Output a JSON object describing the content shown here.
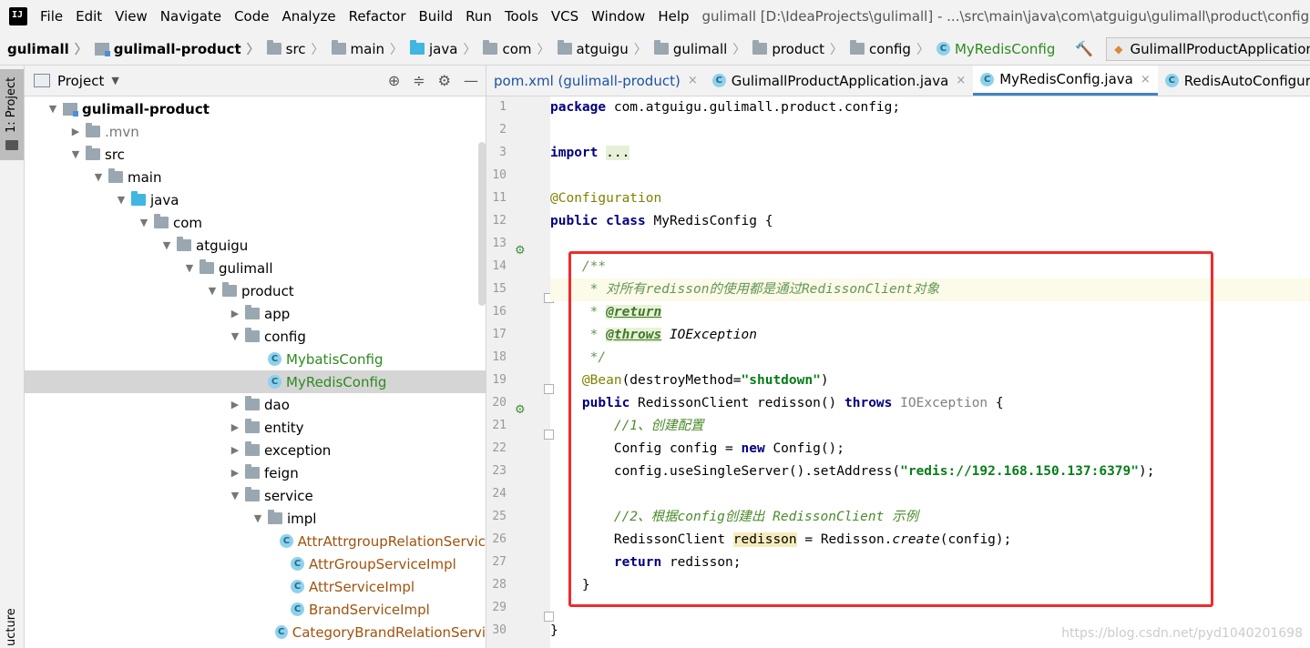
{
  "menubar": {
    "logo_text": "IJ",
    "items": [
      "File",
      "Edit",
      "View",
      "Navigate",
      "Code",
      "Analyze",
      "Refactor",
      "Build",
      "Run",
      "Tools",
      "VCS",
      "Window",
      "Help"
    ],
    "title": "gulimall [D:\\IdeaProjects\\gulimall] - ...\\src\\main\\java\\com\\atguigu\\gulimall\\product\\config"
  },
  "breadcrumb": {
    "items": [
      "gulimall",
      "gulimall-product",
      "src",
      "main",
      "java",
      "com",
      "atguigu",
      "gulimall",
      "product",
      "config",
      "MyRedisConfig"
    ],
    "run_config": "GulimallProductApplicationTests.redisson"
  },
  "side_tabs": {
    "project": "1: Project",
    "structure": "ucture"
  },
  "project_panel": {
    "title": "Project",
    "tree": [
      {
        "label": "gulimall-product",
        "depth": 0,
        "icon": "module-icon",
        "arrow": "down",
        "style": "bold"
      },
      {
        "label": ".mvn",
        "depth": 1,
        "icon": "folder-icon",
        "arrow": "right",
        "style": "gray"
      },
      {
        "label": "src",
        "depth": 1,
        "icon": "folder-icon",
        "arrow": "down",
        "style": ""
      },
      {
        "label": "main",
        "depth": 2,
        "icon": "folder-icon",
        "arrow": "down",
        "style": ""
      },
      {
        "label": "java",
        "depth": 3,
        "icon": "source-folder-icon",
        "arrow": "down",
        "style": ""
      },
      {
        "label": "com",
        "depth": 4,
        "icon": "package-icon",
        "arrow": "down",
        "style": ""
      },
      {
        "label": "atguigu",
        "depth": 5,
        "icon": "package-icon",
        "arrow": "down",
        "style": ""
      },
      {
        "label": "gulimall",
        "depth": 6,
        "icon": "package-icon",
        "arrow": "down",
        "style": ""
      },
      {
        "label": "product",
        "depth": 7,
        "icon": "package-icon",
        "arrow": "down",
        "style": ""
      },
      {
        "label": "app",
        "depth": 8,
        "icon": "package-icon",
        "arrow": "right",
        "style": ""
      },
      {
        "label": "config",
        "depth": 8,
        "icon": "package-icon",
        "arrow": "down",
        "style": ""
      },
      {
        "label": "MybatisConfig",
        "depth": 9,
        "icon": "class-icon",
        "arrow": "",
        "style": "green"
      },
      {
        "label": "MyRedisConfig",
        "depth": 9,
        "icon": "class-icon",
        "arrow": "",
        "style": "green",
        "selected": true
      },
      {
        "label": "dao",
        "depth": 8,
        "icon": "package-icon",
        "arrow": "right",
        "style": ""
      },
      {
        "label": "entity",
        "depth": 8,
        "icon": "package-icon",
        "arrow": "right",
        "style": ""
      },
      {
        "label": "exception",
        "depth": 8,
        "icon": "package-icon",
        "arrow": "right",
        "style": ""
      },
      {
        "label": "feign",
        "depth": 8,
        "icon": "package-icon",
        "arrow": "right",
        "style": ""
      },
      {
        "label": "service",
        "depth": 8,
        "icon": "package-icon",
        "arrow": "down",
        "style": ""
      },
      {
        "label": "impl",
        "depth": 9,
        "icon": "package-icon",
        "arrow": "down",
        "style": ""
      },
      {
        "label": "AttrAttrgroupRelationServic",
        "depth": 10,
        "icon": "class-icon",
        "arrow": "",
        "style": "brown"
      },
      {
        "label": "AttrGroupServiceImpl",
        "depth": 10,
        "icon": "class-icon",
        "arrow": "",
        "style": "brown"
      },
      {
        "label": "AttrServiceImpl",
        "depth": 10,
        "icon": "class-icon",
        "arrow": "",
        "style": "brown"
      },
      {
        "label": "BrandServiceImpl",
        "depth": 10,
        "icon": "class-icon",
        "arrow": "",
        "style": "brown"
      },
      {
        "label": "CategoryBrandRelationServi",
        "depth": 10,
        "icon": "class-icon",
        "arrow": "",
        "style": "brown"
      }
    ]
  },
  "editor": {
    "tabs": [
      {
        "label": "pom.xml (gulimall-product)",
        "icon": "",
        "active": false,
        "close": "×"
      },
      {
        "label": "GulimallProductApplication.java",
        "icon": "class-icon",
        "active": false,
        "close": "×"
      },
      {
        "label": "MyRedisConfig.java",
        "icon": "class-icon",
        "active": true,
        "close": "×"
      },
      {
        "label": "RedisAutoConfigurat",
        "icon": "class-icon",
        "active": false,
        "close": ""
      }
    ],
    "line_numbers": [
      "1",
      "2",
      "3",
      "10",
      "11",
      "12",
      "13",
      "14",
      "15",
      "16",
      "17",
      "18",
      "19",
      "20",
      "21",
      "22",
      "23",
      "24",
      "25",
      "26",
      "27",
      "28",
      "29",
      "30"
    ],
    "code": {
      "l1_kw": "package",
      "l1_rest": " com.atguigu.gulimall.product.config;",
      "l3_kw": "import",
      "l3_dots": "...",
      "l11": "@Configuration",
      "l12_kw": "public class",
      "l12_rest": " MyRedisConfig {",
      "l14": "    /**",
      "l15": "     * 对所有redisson的使用都是通过RedissonClient对象",
      "l16_pre": "     * ",
      "l16_tag": "@return",
      "l17_pre": "     * ",
      "l17_tag": "@throws",
      "l17_rest": " IOException",
      "l18": "     */",
      "l19_ann": "    @Bean",
      "l19_a": "(destroyMethod=",
      "l19_str": "\"shutdown\"",
      "l19_b": ")",
      "l20_kw": "    public",
      "l20_a": " RedissonClient redisson() ",
      "l20_kw2": "throws",
      "l20_exc": " IOException",
      "l20_b": " {",
      "l21": "        //1、创建配置",
      "l22_a": "        Config config = ",
      "l22_kw": "new",
      "l22_b": " Config();",
      "l23_a": "        config.useSingleServer().setAddress(",
      "l23_str": "\"redis://192.168.150.137:6379\"",
      "l23_b": ");",
      "l25": "        //2、根据config创建出 RedissonClient 示例",
      "l26_a": "        RedissonClient ",
      "l26_var": "redisson",
      "l26_b": " = Redisson.",
      "l26_m": "create",
      "l26_c": "(config);",
      "l27_kw": "        return",
      "l27_b": " redisson;",
      "l28": "    }",
      "l30": "}"
    }
  },
  "watermark": "https://blog.csdn.net/pyd1040201698"
}
